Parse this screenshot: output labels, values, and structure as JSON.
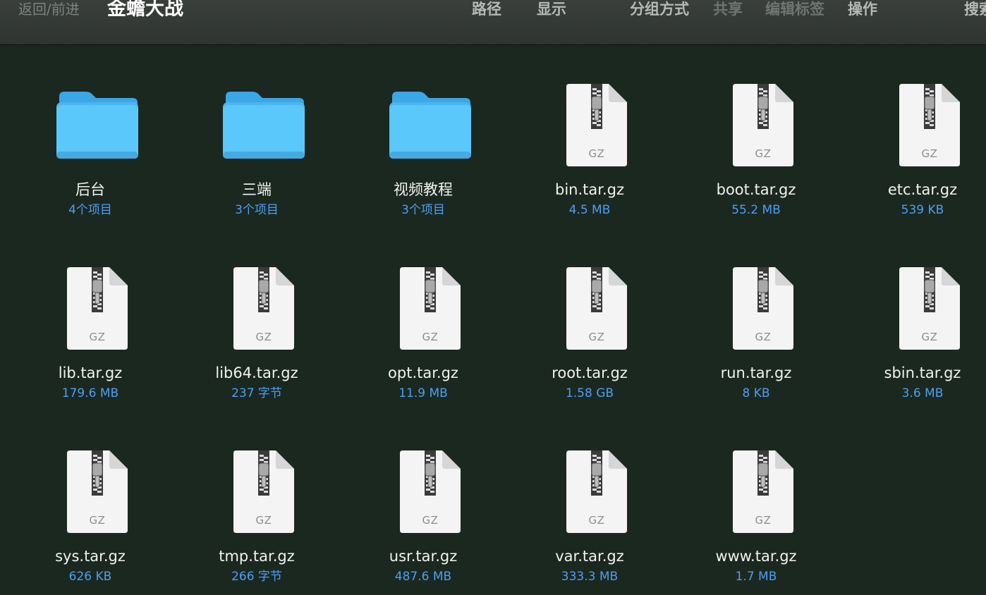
{
  "toolbar": {
    "nav_label": "返回/前进",
    "title": "金蟾大战",
    "path_label": "路径",
    "view_label": "显示",
    "group_label": "分组方式",
    "share_label": "共享",
    "tags_label": "编辑标签",
    "action_label": "操作",
    "search_label": "搜索"
  },
  "icons": {
    "folder": "folder-icon",
    "archive": "gz-archive-icon"
  },
  "colors": {
    "background": "#1b2820",
    "folder": "#5ac8fa",
    "meta_text": "#4b9ff3"
  },
  "files": [
    {
      "name": "后台",
      "meta": "4个项目",
      "kind": "folder",
      "badge": ""
    },
    {
      "name": "三端",
      "meta": "3个项目",
      "kind": "folder",
      "badge": ""
    },
    {
      "name": "视频教程",
      "meta": "3个项目",
      "kind": "folder",
      "badge": ""
    },
    {
      "name": "bin.tar.gz",
      "meta": "4.5 MB",
      "kind": "archive",
      "badge": "GZ"
    },
    {
      "name": "boot.tar.gz",
      "meta": "55.2 MB",
      "kind": "archive",
      "badge": "GZ"
    },
    {
      "name": "etc.tar.gz",
      "meta": "539 KB",
      "kind": "archive",
      "badge": "GZ"
    },
    {
      "name": "lib.tar.gz",
      "meta": "179.6 MB",
      "kind": "archive",
      "badge": "GZ"
    },
    {
      "name": "lib64.tar.gz",
      "meta": "237 字节",
      "kind": "archive",
      "badge": "GZ"
    },
    {
      "name": "opt.tar.gz",
      "meta": "11.9 MB",
      "kind": "archive",
      "badge": "GZ"
    },
    {
      "name": "root.tar.gz",
      "meta": "1.58 GB",
      "kind": "archive",
      "badge": "GZ"
    },
    {
      "name": "run.tar.gz",
      "meta": "8 KB",
      "kind": "archive",
      "badge": "GZ"
    },
    {
      "name": "sbin.tar.gz",
      "meta": "3.6 MB",
      "kind": "archive",
      "badge": "GZ"
    },
    {
      "name": "sys.tar.gz",
      "meta": "626 KB",
      "kind": "archive",
      "badge": "GZ"
    },
    {
      "name": "tmp.tar.gz",
      "meta": "266 字节",
      "kind": "archive",
      "badge": "GZ"
    },
    {
      "name": "usr.tar.gz",
      "meta": "487.6 MB",
      "kind": "archive",
      "badge": "GZ"
    },
    {
      "name": "var.tar.gz",
      "meta": "333.3 MB",
      "kind": "archive",
      "badge": "GZ"
    },
    {
      "name": "www.tar.gz",
      "meta": "1.7 MB",
      "kind": "archive",
      "badge": "GZ"
    }
  ]
}
